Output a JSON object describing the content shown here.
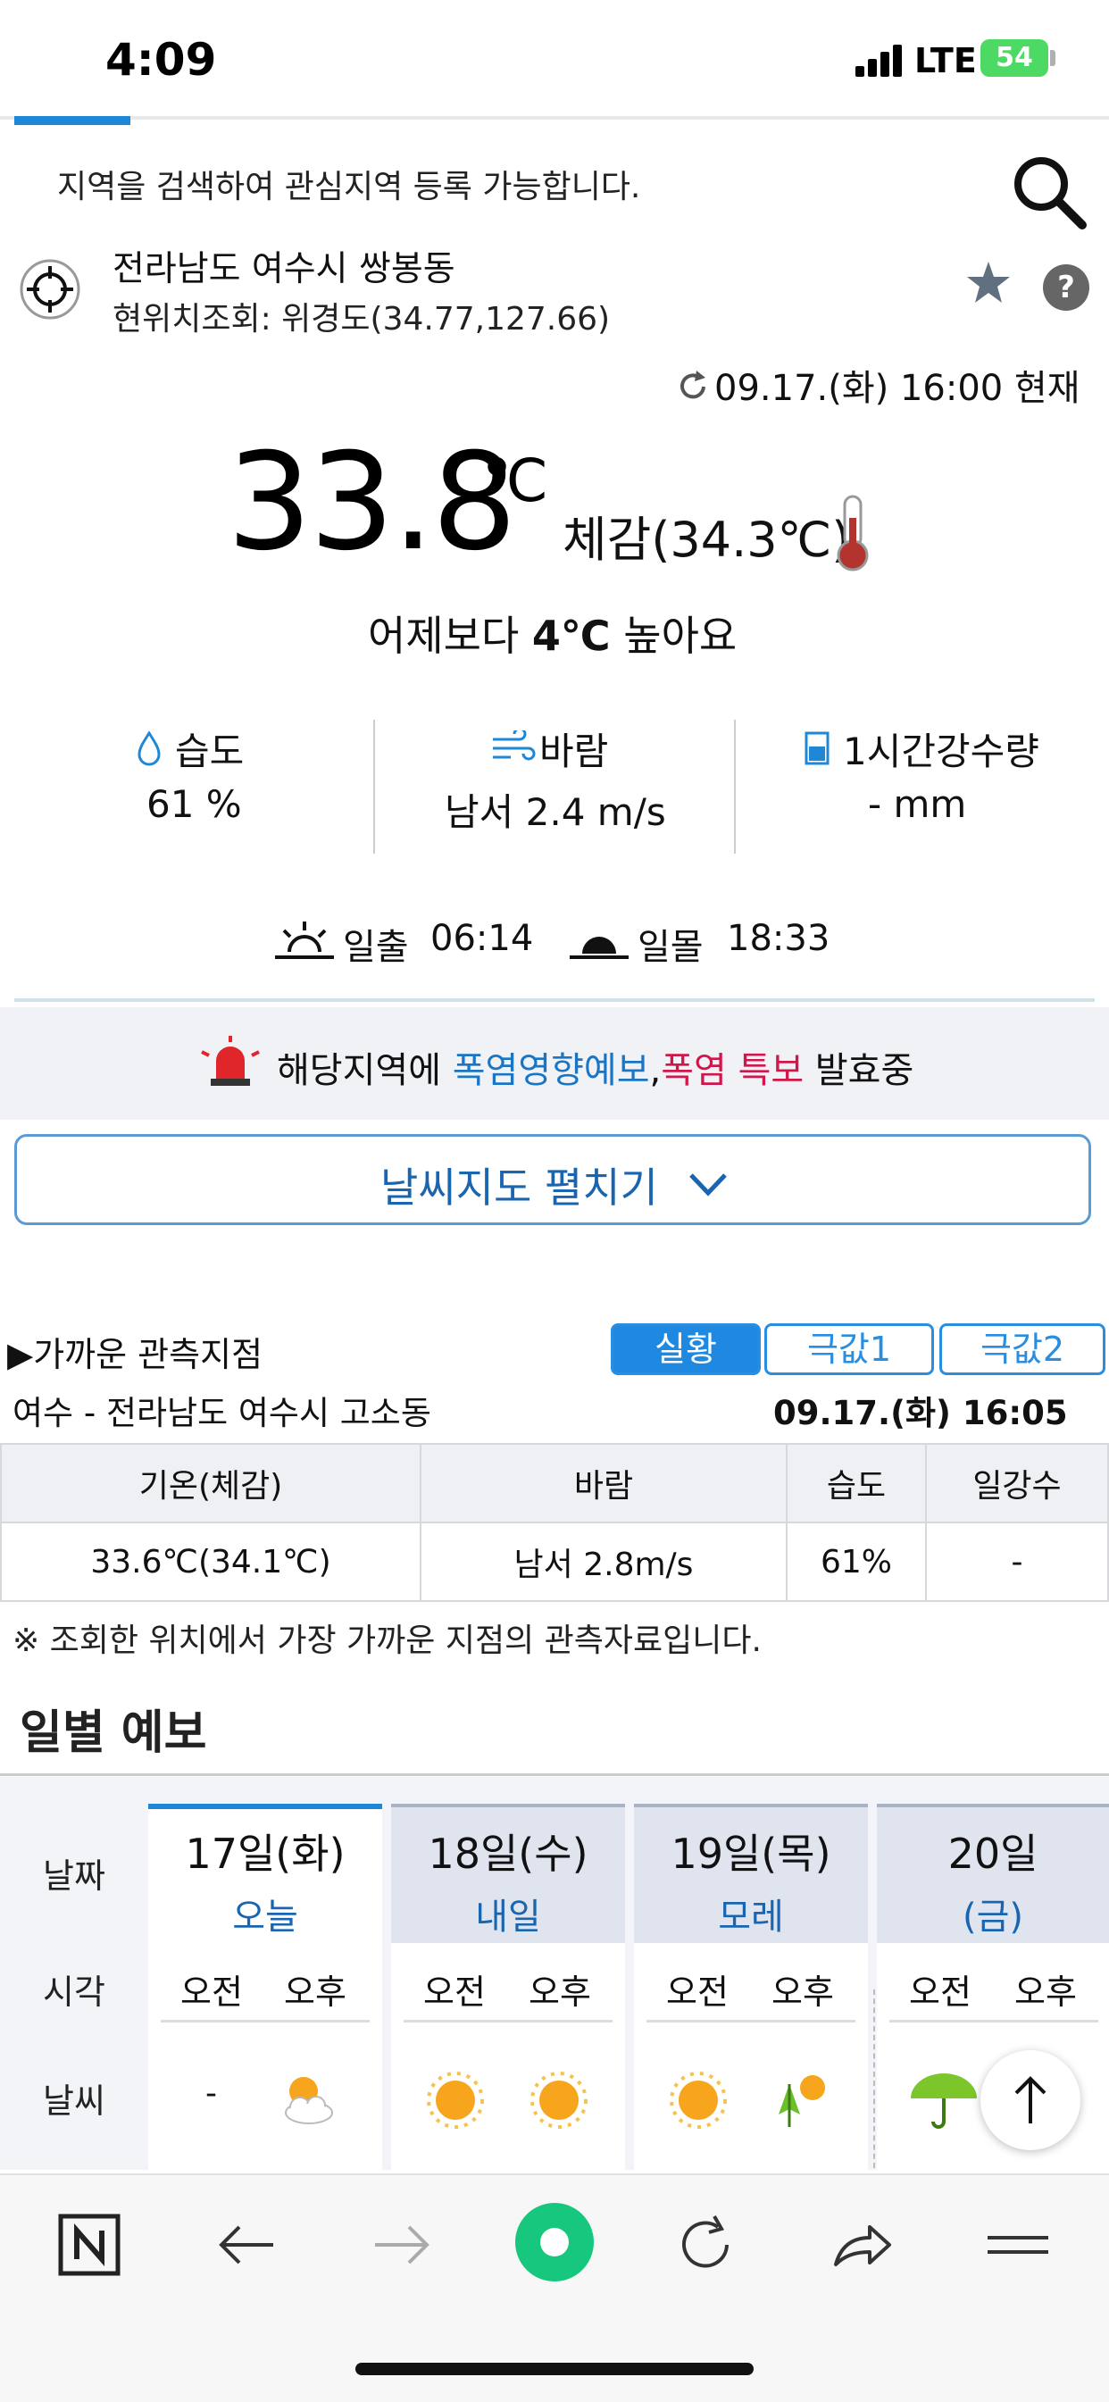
{
  "status_bar": {
    "time": "4:09",
    "network": "LTE",
    "battery": "54"
  },
  "search": {
    "hint": "지역을 검색하여 관심지역 등록 가능합니다."
  },
  "location": {
    "name": "전라남도 여수시 쌍봉동",
    "coord": "현위치조회: 위경도(34.77,127.66)"
  },
  "current": {
    "time": "09.17.(화) 16:00 현재",
    "temp": "33.8",
    "unit": "℃",
    "feels": "체감(34.3℃)",
    "compare_pre": "어제보다 ",
    "compare_value": "4℃",
    "compare_post": " 높아요",
    "humidity_label": "습도",
    "humidity_value": "61 %",
    "wind_label": "바람",
    "wind_value": "남서 2.4 m/s",
    "rain_label": "1시간강수량",
    "rain_value": "- mm",
    "sunrise_label": "일출",
    "sunrise": "06:14",
    "sunset_label": "일몰",
    "sunset": "18:33"
  },
  "alert": {
    "pre": "해당지역에 ",
    "blue": "폭염영향예보",
    "comma": ",",
    "red": "폭염 특보",
    "post": " 발효중"
  },
  "map_button": {
    "label": "날씨지도 펼치기"
  },
  "nearby": {
    "title": "▶가까운 관측지점",
    "tabs": [
      "실황",
      "극값1",
      "극값2"
    ],
    "station": "여수 - 전라남도 여수시 고소동",
    "time": "09.17.(화) 16:05 현재",
    "headers": [
      "기온(체감)",
      "바람",
      "습도",
      "일강수"
    ],
    "row": [
      "33.6℃(34.1℃)",
      "남서 2.8m/s",
      "61%",
      "-"
    ],
    "note": "※ 조회한 위치에서 가장 가까운 지점의 관측자료입니다."
  },
  "daily": {
    "title": "일별 예보",
    "row_labels": {
      "date": "날짜",
      "time": "시각",
      "weather": "날씨"
    },
    "am": "오전",
    "pm": "오후",
    "days": [
      {
        "name": "17일(화)",
        "sub": "오늘",
        "am_weather": "-"
      },
      {
        "name": "18일(수)",
        "sub": "내일"
      },
      {
        "name": "19일(목)",
        "sub": "모레"
      },
      {
        "name": "20일",
        "sub": "(금)"
      }
    ]
  },
  "colors": {
    "accent": "#1f88d6",
    "alert_red": "#d0164a",
    "alert_blue": "#1a75c4",
    "cta_green": "#17c77e"
  }
}
